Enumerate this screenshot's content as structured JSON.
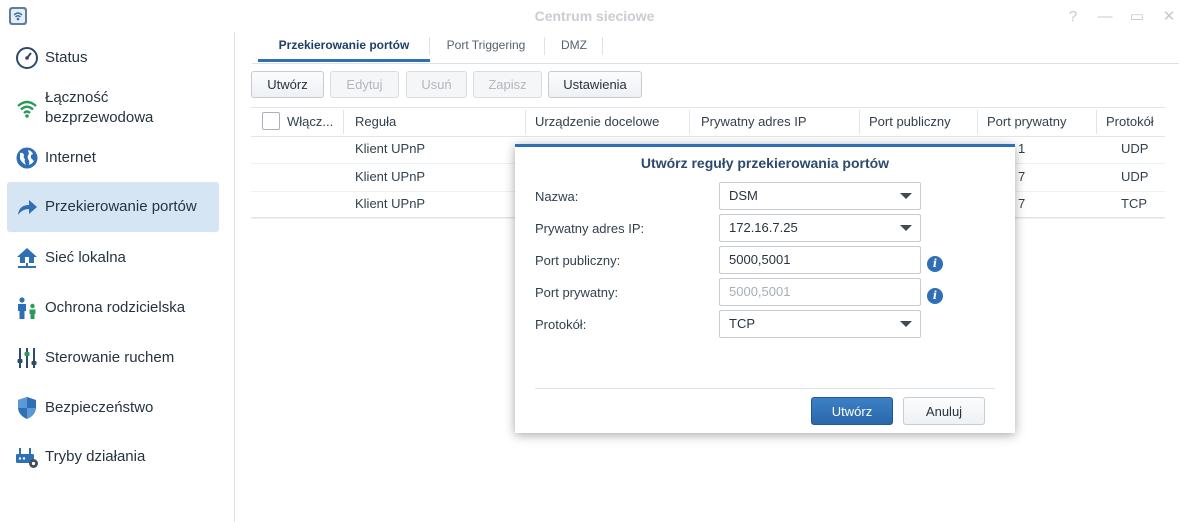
{
  "window": {
    "title": "Centrum sieciowe",
    "controls": [
      {
        "icon": "help-icon",
        "glyph": "?"
      },
      {
        "icon": "minimize-icon",
        "glyph": "—"
      },
      {
        "icon": "maximize-icon",
        "glyph": "▭"
      },
      {
        "icon": "close-icon",
        "glyph": "✕"
      }
    ]
  },
  "sidebar": {
    "items": [
      {
        "label": "Status",
        "icon": "gauge-icon"
      },
      {
        "label": "Łączność bezprzewodowa",
        "icon": "wifi-icon"
      },
      {
        "label": "Internet",
        "icon": "globe-icon"
      },
      {
        "label": "Przekierowanie portów",
        "icon": "forward-arrow-icon",
        "active": true
      },
      {
        "label": "Sieć lokalna",
        "icon": "house-network-icon"
      },
      {
        "label": "Ochrona rodzicielska",
        "icon": "parent-child-icon"
      },
      {
        "label": "Sterowanie ruchem",
        "icon": "sliders-icon"
      },
      {
        "label": "Bezpieczeństwo",
        "icon": "shield-icon"
      },
      {
        "label": "Tryby działania",
        "icon": "router-gear-icon"
      }
    ]
  },
  "tabs": [
    {
      "label": "Przekierowanie portów",
      "active": true
    },
    {
      "label": "Port Triggering"
    },
    {
      "label": "DMZ"
    }
  ],
  "toolbar": {
    "create": "Utwórz",
    "edit": "Edytuj",
    "delete": "Usuń",
    "save": "Zapisz",
    "settings": "Ustawienia"
  },
  "table": {
    "headers": {
      "enabled": "Włącz...",
      "rule": "Reguła",
      "device": "Urządzenie docelowe",
      "private_ip": "Prywatny adres IP",
      "public_port": "Port publiczny",
      "private_port": "Port prywatny",
      "protocol": "Protokół"
    },
    "rows": [
      {
        "rule": "Klient UPnP",
        "private_port": "1",
        "protocol": "UDP"
      },
      {
        "rule": "Klient UPnP",
        "private_port": "7",
        "protocol": "UDP"
      },
      {
        "rule": "Klient UPnP",
        "private_port": "7",
        "protocol": "TCP"
      }
    ]
  },
  "dialog": {
    "title": "Utwórz reguły przekierowania portów",
    "fields": {
      "name_label": "Nazwa:",
      "name_value": "DSM",
      "ip_label": "Prywatny adres IP:",
      "ip_value": "172.16.7.25",
      "public_port_label": "Port publiczny:",
      "public_port_value": "5000,5001",
      "private_port_label": "Port prywatny:",
      "private_port_placeholder": "5000,5001",
      "protocol_label": "Protokół:",
      "protocol_value": "TCP"
    },
    "buttons": {
      "ok": "Utwórz",
      "cancel": "Anuluj"
    }
  },
  "colors": {
    "accent": "#2f6fb5",
    "active_bg": "#d6e5f4"
  }
}
